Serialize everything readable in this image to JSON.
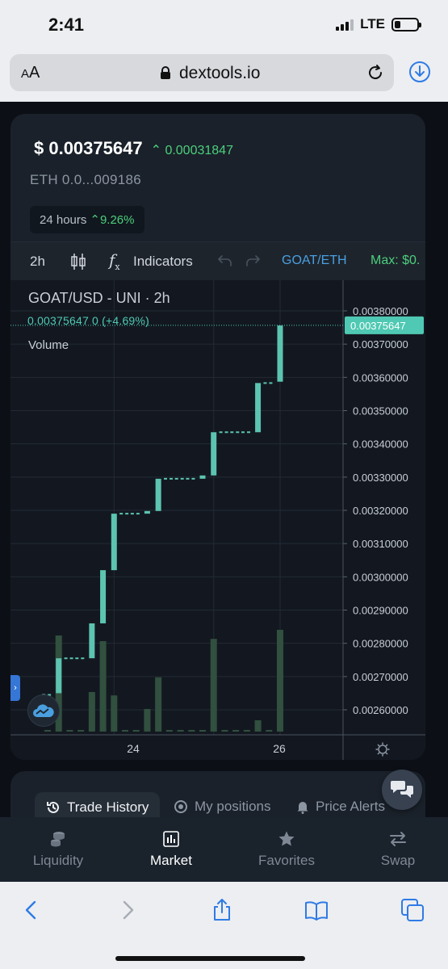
{
  "status_bar": {
    "time": "2:41",
    "network": "LTE",
    "signal_bars": 3,
    "signal_total": 4,
    "battery_level": 0.25
  },
  "browser": {
    "text_size_small": "A",
    "text_size_large": "A",
    "url": "dextools.io"
  },
  "price": {
    "usd": "$ 0.00375647",
    "change": "0.00031847",
    "eth": "ETH  0.0...009186",
    "range_label": "24 hours",
    "range_change": "9.26%"
  },
  "toolbar": {
    "interval": "2h",
    "indicators_label": "Indicators",
    "fx_label": "f",
    "pair": "GOAT/ETH",
    "max_label": "Max: $0."
  },
  "chart": {
    "legend_title": "GOAT/USD - UNI · 2h",
    "legend_value": "0.00375647  0  (+4.69%)",
    "legend_volume": "Volume",
    "current_price_label": "0.00375647",
    "y_ticks": [
      "0.00380000",
      "0.00370000",
      "0.00360000",
      "0.00350000",
      "0.00340000",
      "0.00330000",
      "0.00320000",
      "0.00310000",
      "0.00300000",
      "0.00290000",
      "0.00280000",
      "0.00270000",
      "0.00260000"
    ],
    "x_ticks": [
      "24",
      "26"
    ],
    "side_tab_label": "›"
  },
  "chart_data": {
    "type": "candlestick",
    "title": "GOAT/USD - UNI · 2h",
    "ylim": [
      0.00255,
      0.00385
    ],
    "current_price": 0.00375647,
    "x_tick_labels": [
      "24",
      "26"
    ],
    "candles": [
      {
        "open": 0.002645,
        "close": 0.002645,
        "volume": 0
      },
      {
        "open": 0.00265,
        "close": 0.002755,
        "volume": 0.85
      },
      {
        "open": 0.002755,
        "close": 0.002755,
        "volume": 0
      },
      {
        "open": 0.002755,
        "close": 0.002755,
        "volume": 0
      },
      {
        "open": 0.002755,
        "close": 0.00286,
        "volume": 0.35
      },
      {
        "open": 0.00286,
        "close": 0.00302,
        "volume": 0.8
      },
      {
        "open": 0.00302,
        "close": 0.00319,
        "volume": 0.32
      },
      {
        "open": 0.00319,
        "close": 0.00319,
        "volume": 0
      },
      {
        "open": 0.00319,
        "close": 0.00319,
        "volume": 0
      },
      {
        "open": 0.00319,
        "close": 0.003198,
        "volume": 0.2
      },
      {
        "open": 0.003198,
        "close": 0.003295,
        "volume": 0.48
      },
      {
        "open": 0.003295,
        "close": 0.003295,
        "volume": 0
      },
      {
        "open": 0.003295,
        "close": 0.003295,
        "volume": 0
      },
      {
        "open": 0.003295,
        "close": 0.003295,
        "volume": 0
      },
      {
        "open": 0.003295,
        "close": 0.003305,
        "volume": 0
      },
      {
        "open": 0.003305,
        "close": 0.003435,
        "volume": 0.82
      },
      {
        "open": 0.003435,
        "close": 0.003435,
        "volume": 0
      },
      {
        "open": 0.003435,
        "close": 0.003435,
        "volume": 0
      },
      {
        "open": 0.003435,
        "close": 0.003435,
        "volume": 0
      },
      {
        "open": 0.003435,
        "close": 0.003583,
        "volume": 0.1
      },
      {
        "open": 0.003583,
        "close": 0.003583,
        "volume": 0
      },
      {
        "open": 0.003587,
        "close": 0.003756,
        "volume": 0.9
      }
    ]
  },
  "history": {
    "tab_trade_history": "Trade History",
    "tab_my_positions": "My positions",
    "tab_price_alerts": "Price Alerts"
  },
  "bottom_nav": {
    "liquidity": "Liquidity",
    "market": "Market",
    "favorites": "Favorites",
    "swap": "Swap"
  },
  "colors": {
    "up": "#4ccf7c",
    "candle": "#5cc4b0",
    "volume": "#31503f",
    "accent_blue": "#4a9fe0"
  }
}
